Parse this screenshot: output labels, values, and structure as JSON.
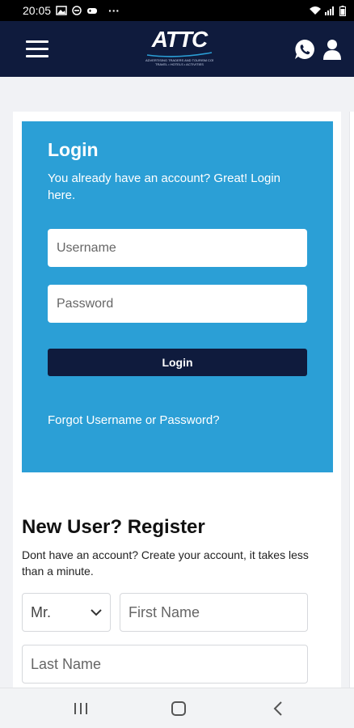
{
  "status_bar": {
    "time": "20:05",
    "more": "···"
  },
  "app_bar": {
    "logo_text": "ATTC",
    "logo_tagline_1": "ADVERTISING TRADERS AND TOURISM COMPANY",
    "logo_tagline_2": "TRAVEL • HOTELS • ACTIVITIES"
  },
  "login": {
    "title": "Login",
    "subtitle": "You already have an account? Great! Login here.",
    "username_placeholder": "Username",
    "password_placeholder": "Password",
    "button_label": "Login",
    "forgot_link": "Forgot Username or Password?"
  },
  "register": {
    "title": "New User? Register",
    "subtitle": "Dont have an account? Create your account, it takes less than a minute.",
    "salutation_selected": "Mr.",
    "first_name_placeholder": "First Name",
    "last_name_placeholder": "Last Name"
  },
  "colors": {
    "navy": "#0f1b3d",
    "login_blue": "#2b9fd6"
  }
}
